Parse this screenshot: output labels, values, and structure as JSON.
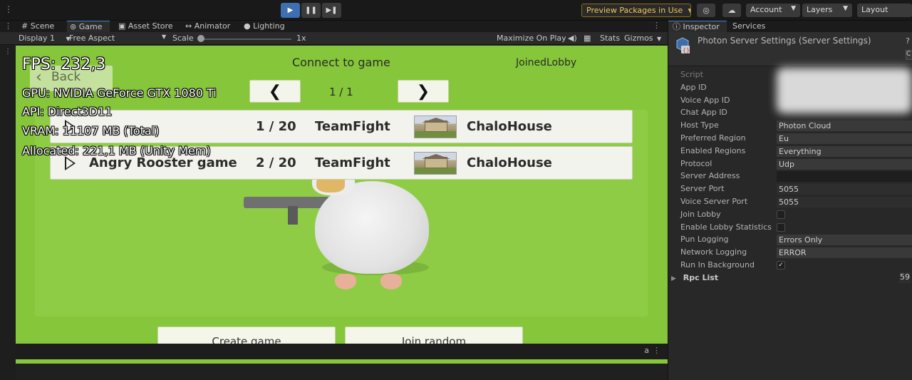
{
  "toolbar": {
    "preview_label": "Preview Packages in Use",
    "account_label": "Account",
    "layers_label": "Layers",
    "layout_label": "Layout",
    "play_glyph": "▶",
    "pause_glyph": "❚❚",
    "step_glyph": "▶❚",
    "icons": [
      "play-icon",
      "pause-icon",
      "step-icon",
      "collab-icon",
      "cloud-icon"
    ]
  },
  "tabs": {
    "scene": "Scene",
    "game": "Game",
    "asset_store": "Asset Store",
    "animator": "Animator",
    "lighting": "Lighting"
  },
  "game_bar": {
    "display": "Display 1",
    "aspect": "Free Aspect",
    "scale_label": "Scale",
    "scale_value": "1x",
    "maximize": "Maximize On Play",
    "stats": "Stats",
    "gizmos": "Gizmos"
  },
  "stats": {
    "fps": "FPS: 232,3",
    "gpu": "GPU: NVIDIA GeForce GTX 1080 Ti",
    "api": "API: Direct3D11",
    "vram": "VRAM: 11107 MB (Total)",
    "allocated": "Allocated: 221,1 MB (Unity Mem)"
  },
  "game": {
    "title": "Connect to game",
    "status": "JoinedLobby",
    "back_label": "Back",
    "prev_glyph": "❮",
    "next_glyph": "❯",
    "page": "1 / 1",
    "rooms": [
      {
        "name": "",
        "count": "1 / 20",
        "mode": "TeamFight",
        "map": "ChaloHouse"
      },
      {
        "name": "Angry Rooster game",
        "count": "2 / 20",
        "mode": "TeamFight",
        "map": "ChaloHouse"
      }
    ],
    "create_label": "Create game",
    "join_label": "Join random"
  },
  "inspector": {
    "tab_inspector": "Inspector",
    "tab_services": "Services",
    "asset_title": "Photon Server Settings (Server Settings)",
    "properties": [
      {
        "label": "Script",
        "value": "",
        "kind": "blank"
      },
      {
        "label": "App ID",
        "value": "",
        "kind": "blank"
      },
      {
        "label": "Voice App ID",
        "value": "",
        "kind": "blank"
      },
      {
        "label": "Chat App ID",
        "value": "",
        "kind": "blank"
      },
      {
        "label": "Host Type",
        "value": "Photon Cloud",
        "kind": "drop"
      },
      {
        "label": "Preferred Region",
        "value": "Eu",
        "kind": "drop"
      },
      {
        "label": "Enabled Regions",
        "value": "Everything",
        "kind": "drop"
      },
      {
        "label": "Protocol",
        "value": "Udp",
        "kind": "drop"
      },
      {
        "label": "Server Address",
        "value": "",
        "kind": "text"
      },
      {
        "label": "Server Port",
        "value": "5055",
        "kind": "text"
      },
      {
        "label": "Voice Server Port",
        "value": "5055",
        "kind": "text"
      },
      {
        "label": "Join Lobby",
        "value": "",
        "kind": "check",
        "checked": false
      },
      {
        "label": "Enable Lobby Statistics",
        "value": "",
        "kind": "check",
        "checked": false
      },
      {
        "label": "Pun Logging",
        "value": "Errors Only",
        "kind": "drop"
      },
      {
        "label": "Network Logging",
        "value": "ERROR",
        "kind": "drop"
      },
      {
        "label": "Run In Background",
        "value": "",
        "kind": "check",
        "checked": true
      }
    ],
    "rpc_label": "Rpc List",
    "rpc_count": "59"
  }
}
